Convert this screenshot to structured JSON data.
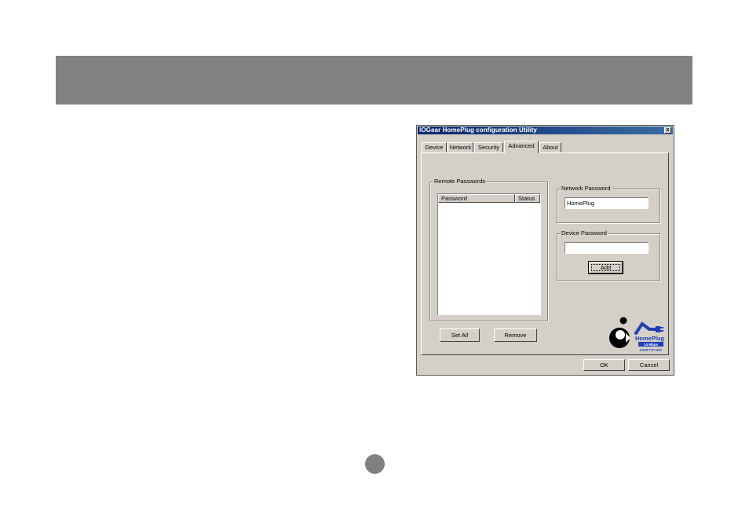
{
  "dialog": {
    "title": "IOGear HomePlug configuration Utility",
    "close_glyph": "x"
  },
  "tabs": [
    {
      "label": "Device"
    },
    {
      "label": "Network"
    },
    {
      "label": "Security"
    },
    {
      "label": "Advanced"
    },
    {
      "label": "About"
    }
  ],
  "active_tab": "Advanced",
  "remote_passwords": {
    "group_label": "Remote Passwords",
    "columns": [
      "Password",
      "Status"
    ],
    "rows": []
  },
  "network_password": {
    "group_label": "Network Password",
    "value": "HomePlug"
  },
  "device_password": {
    "group_label": "Device Password",
    "value": "",
    "add_label": "Add"
  },
  "buttons": {
    "set_all": "Set All",
    "remove": "Remove",
    "ok": "OK",
    "cancel": "Cancel"
  },
  "logo": {
    "brand": "HomePlug",
    "speed": "14 Mbps",
    "certified": "CERTIFIED",
    "colors": {
      "blue": "#1f3fb5",
      "black": "#000000"
    }
  },
  "colors": {
    "banner": "#808284",
    "dialog_face": "#d4d0c8",
    "titlebar": "#0a246a"
  }
}
